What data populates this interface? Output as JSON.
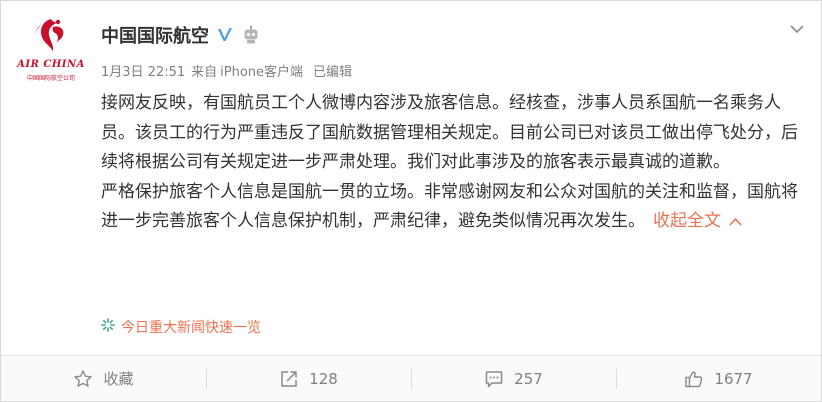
{
  "author": {
    "name": "中国国际航空",
    "logo_text": "AIR CHINA",
    "logo_subtext": "中国国际航空公司",
    "verified_icon": "verified-v-icon",
    "robot_icon": "robot-icon"
  },
  "meta": {
    "time": "1月3日 22:51",
    "source_prefix": "来自",
    "source": "iPhone客户端",
    "edited": "已编辑"
  },
  "content": {
    "paragraphs": [
      "接网友反映，有国航员工个人微博内容涉及旅客信息。经核查，涉事人员系国航一名乘务人员。该员工的行为严重违反了国航数据管理相关规定。目前公司已对该员工做出停飞处分，后续将根据公司有关规定进一步严肃处理。我们对此事涉及的旅客表示最真诚的道歉。",
      "严格保护旅客个人信息是国航一贯的立场。非常感谢网友和公众对国航的关注和监督，国航将进一步完善旅客个人信息保护机制，严肃纪律，避免类似情况再次发生。"
    ],
    "collapse_label": "收起全文",
    "topic": "今日重大新闻快速一览"
  },
  "actions": {
    "favorite_label": "收藏",
    "repost_count": "128",
    "comment_count": "257",
    "like_count": "1677"
  },
  "colors": {
    "accent": "#eb7350",
    "brand_red": "#c8102e",
    "verified_blue": "#4aa0ea",
    "meta_gray": "#808080"
  }
}
